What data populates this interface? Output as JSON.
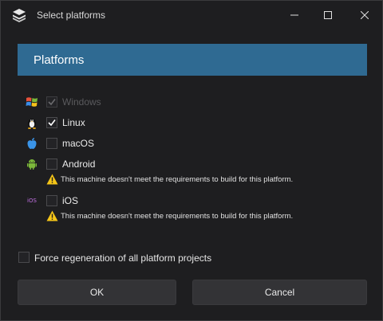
{
  "window": {
    "title": "Select platforms"
  },
  "header": {
    "title": "Platforms"
  },
  "platforms": [
    {
      "label": "Windows",
      "checked": true,
      "enabled": false,
      "icon": "windows-icon"
    },
    {
      "label": "Linux",
      "checked": true,
      "enabled": true,
      "icon": "linux-tux-icon"
    },
    {
      "label": "macOS",
      "checked": false,
      "enabled": true,
      "icon": "apple-icon"
    },
    {
      "label": "Android",
      "checked": false,
      "enabled": true,
      "icon": "android-icon",
      "warning": "This machine doesn't meet the requirements to build for this platform."
    },
    {
      "label": "iOS",
      "checked": false,
      "enabled": true,
      "icon": "ios-icon",
      "icon_text": "iOS",
      "warning": "This machine doesn't meet the requirements to build for this platform."
    }
  ],
  "options": {
    "force_label": "Force regeneration of all platform projects",
    "force_checked": false
  },
  "buttons": {
    "ok_label": "OK",
    "cancel_label": "Cancel"
  },
  "colors": {
    "header_bg": "#2f6a92",
    "warning": "#f5c518",
    "window_bg": "#1e1e20"
  }
}
